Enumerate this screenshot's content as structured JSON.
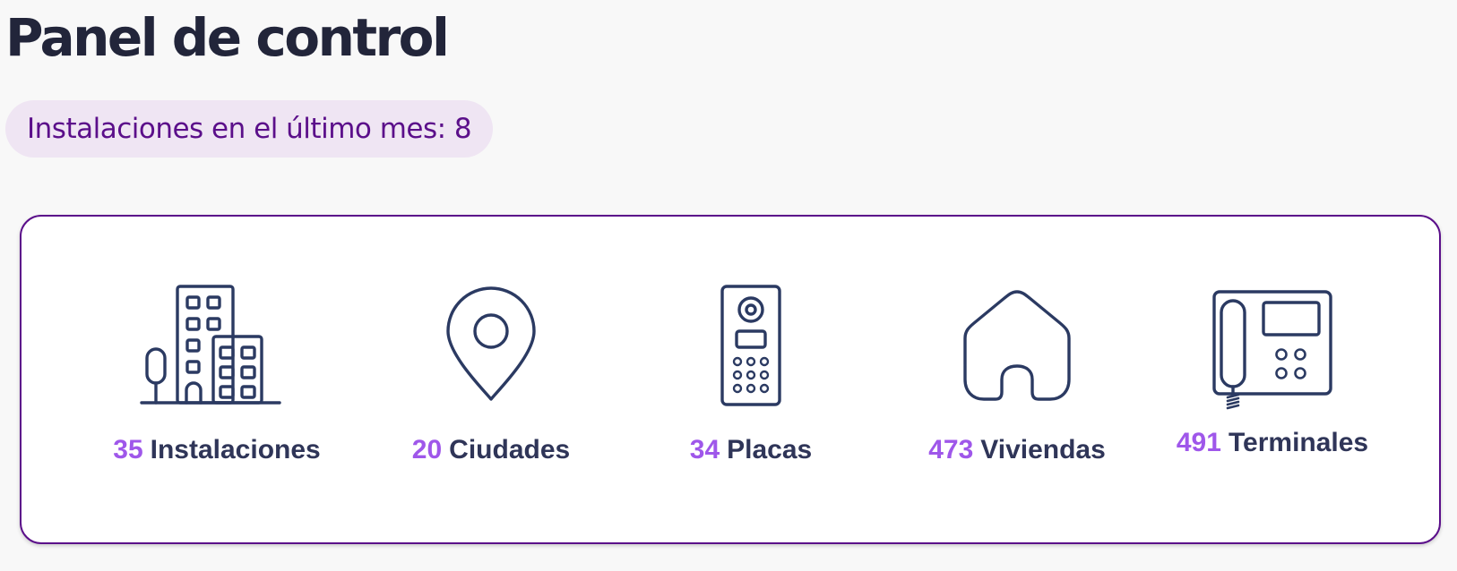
{
  "header": {
    "title": "Panel de control"
  },
  "badge": {
    "text": "Instalaciones en el último mes: 8"
  },
  "stats": [
    {
      "value": "35",
      "label": "Instalaciones",
      "icon": "buildings-icon"
    },
    {
      "value": "20",
      "label": "Ciudades",
      "icon": "location-pin-icon"
    },
    {
      "value": "34",
      "label": "Placas",
      "icon": "intercom-panel-icon"
    },
    {
      "value": "473",
      "label": "Viviendas",
      "icon": "house-icon"
    },
    {
      "value": "491",
      "label": "Terminales",
      "icon": "intercom-phone-icon"
    }
  ],
  "colors": {
    "title": "#22253a",
    "accent": "#9f57ea",
    "brand_purple": "#5b0f8a",
    "badge_background": "#efe5f3",
    "icon_stroke": "#2b3a62"
  }
}
